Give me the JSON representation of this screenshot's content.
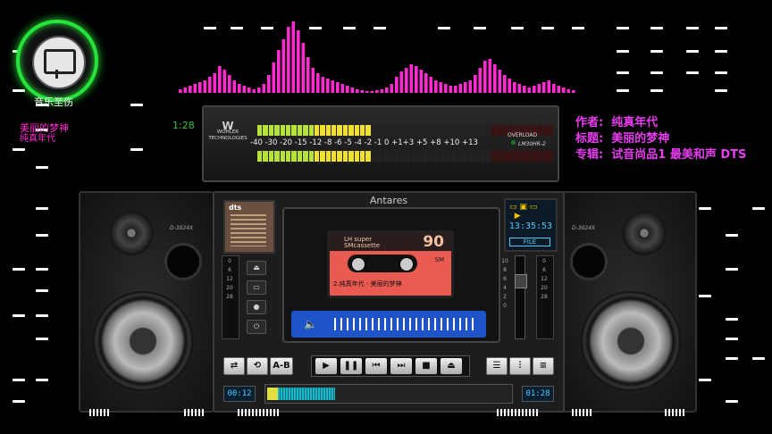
{
  "app": {
    "title": "音乐至伤"
  },
  "track": {
    "song": "美丽的梦神",
    "artist": "纯真年代",
    "elapsed": "1:28"
  },
  "meta": {
    "author_label": "作者:",
    "author": "纯真年代",
    "title_label": "标题:",
    "title": "美丽的梦神",
    "album_label": "专辑:",
    "album": "试音尚品1 最美和声 DTS"
  },
  "vu": {
    "brand_line1": "WOHLER",
    "brand_line2": "TECHNOLOGIES",
    "scale": "-40 -30     -20 -15   -12 -8 -6 -5 -4 -2 -1 0 +1+3  +5  +8 +10 +13",
    "overload": "OVERLOAD",
    "model": "LM30HR-2",
    "level": 0.38
  },
  "deck": {
    "name": "Antares",
    "dts": "dts",
    "cd_time": "13:35:53",
    "file_label": "FILE",
    "cassette": {
      "brand1": "LH super",
      "brand2": "SMcassette",
      "rating": "90",
      "sm": "SM",
      "label": "2.纯真年代 - 美丽的梦神"
    },
    "ab_label": "A-B"
  },
  "progress": {
    "current": "00:12",
    "total": "01:28",
    "fraction": 0.28
  },
  "speakers": {
    "left_model": "D-3024X",
    "right_model": "D-3024X"
  },
  "colors": {
    "accent_pink": "#ff2bd0",
    "accent_green": "#27e33a",
    "meta_purple": "#e83df0",
    "volume_blue": "#1e54c9"
  }
}
